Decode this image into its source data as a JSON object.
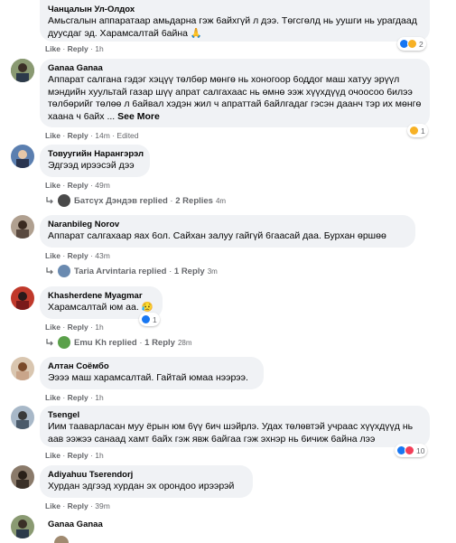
{
  "comments": [
    {
      "author": "Чанцалын Ул-Олдох",
      "text": "Амьсгалын аппаратаар амьдарна гэж 6айхгүй л дээ. Төгсгөлд нь уушги нь урагдаад дуусдаг эд. Харамсалтай 6айна 🙏",
      "like": "Like",
      "reply": "Reply",
      "time": "1h",
      "reaction_count": "2"
    },
    {
      "author": "Ganaa Ganaa",
      "text": "Аппарат салгана гэдэг хэцүү төлбөр мөнгө нь хоногоор 6оддог маш хатуу эрүүл мэндийн хуультай газар шүү апрат салгахаас нь өмнө ээж хүүхдүүд очоосоо 6илээ төлбөрийг төлөө л 6айвал хэдэн жил ч апраттай 6айлгадаг гэсэн даанч тэр их мөнгө хаана ч 6айх ...",
      "see_more": "See More",
      "like": "Like",
      "reply": "Reply",
      "time": "14m",
      "edited": "Edited",
      "reaction_count": "1"
    },
    {
      "author": "Товуугийн Нарангэрэл",
      "text": "Эдгээд ирээсэй дээ",
      "like": "Like",
      "reply": "Reply",
      "time": "49m",
      "replied_by": "Батсүх Дэндэв replied",
      "replies": "2 Replies",
      "replies_time": "4m"
    },
    {
      "author": "Naranbileg Norov",
      "text": "Аппарат салгахаар яах 6ол. Сайхан залуу гайгүй 6гаасай даа. Бурхан өршөө",
      "like": "Like",
      "reply": "Reply",
      "time": "43m",
      "replied_by": "Taria Arvintaria replied",
      "replies": "1 Reply",
      "replies_time": "3m"
    },
    {
      "author": "Khasherdene Myagmar",
      "text": "Харамсалтай юм аа. 😥",
      "like": "Like",
      "reply": "Reply",
      "time": "1h",
      "reaction_count": "1",
      "replied_by": "Emu Kh replied",
      "replies": "1 Reply",
      "replies_time": "28m"
    },
    {
      "author": "Алтан Соёмбо",
      "text": "Ээээ маш харамсалтай. Гайтай юмаа нээрээ.",
      "like": "Like",
      "reply": "Reply",
      "time": "1h"
    },
    {
      "author": "Tsengel",
      "text": "Иим тааварласан муу ёрын юм 6үү 6ич шэйрлэ. Удах төлөвтэй учраас хүүхдүүд нь аав ээжээ санаад хамт 6айх гэж явж 6айгаа гэж эхнэр нь 6ичиж 6айна лээ",
      "like": "Like",
      "reply": "Reply",
      "time": "1h",
      "reaction_count": "10"
    },
    {
      "author": "Adiyahuu Tserendorj",
      "text": "Хурдан эдгээд хурдан эх орондоо ирээрэй",
      "like": "Like",
      "reply": "Reply",
      "time": "39m"
    },
    {
      "author": "Ganaa Ganaa"
    }
  ],
  "colors": {
    "bubble": "#f0f2f5",
    "meta": "#65676b",
    "like_blue": "#1877f2"
  }
}
